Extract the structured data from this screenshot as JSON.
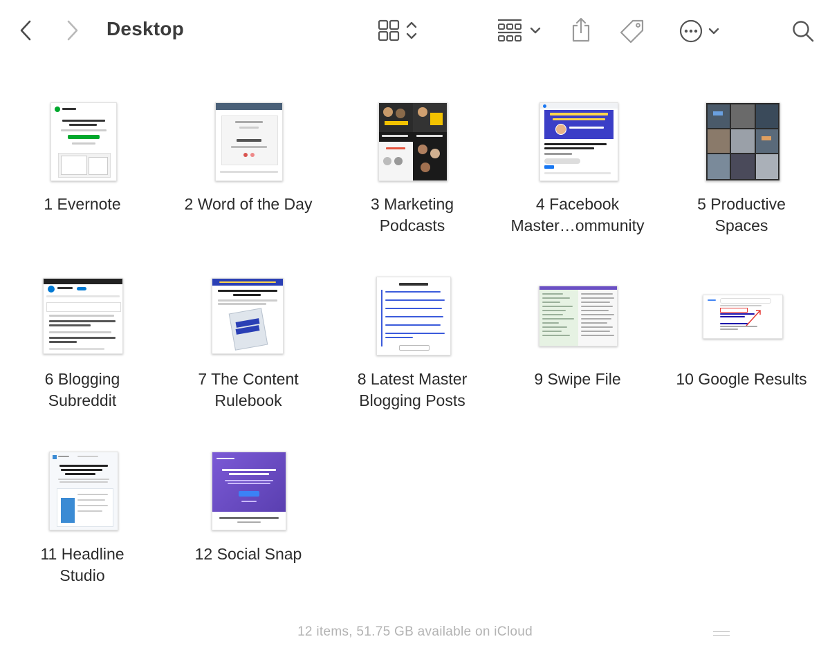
{
  "window": {
    "title": "Desktop"
  },
  "toolbar": {
    "back_icon": "chevron-left-icon",
    "forward_icon": "chevron-right-icon",
    "view_icon": "icon-grid-view-icon",
    "group_icon": "group-by-icon",
    "share_icon": "share-icon",
    "tag_icon": "tag-icon",
    "more_icon": "ellipsis-circle-icon",
    "search_icon": "search-icon"
  },
  "items": [
    {
      "line1": "1 Evernote",
      "line2": ""
    },
    {
      "line1": "2 Word of the Day",
      "line2": ""
    },
    {
      "line1": "3 Marketing",
      "line2": "Podcasts"
    },
    {
      "line1": "4 Facebook",
      "line2": "Master…ommunity"
    },
    {
      "line1": "5 Productive",
      "line2": "Spaces"
    },
    {
      "line1": "6 Blogging",
      "line2": "Subreddit"
    },
    {
      "line1": "7 The Content",
      "line2": "Rulebook"
    },
    {
      "line1": "8 Latest Master",
      "line2": "Blogging Posts"
    },
    {
      "line1": "9 Swipe File",
      "line2": ""
    },
    {
      "line1": "10 Google Results",
      "line2": ""
    },
    {
      "line1": "11 Headline",
      "line2": "Studio"
    },
    {
      "line1": "12 Social Snap",
      "line2": ""
    }
  ],
  "status": {
    "text": "12 items, 51.75 GB available on iCloud"
  },
  "colors": {
    "accent": "#3b5bdb",
    "facebook_blue": "#1877f2",
    "social_purple": "#6a4fc4"
  }
}
